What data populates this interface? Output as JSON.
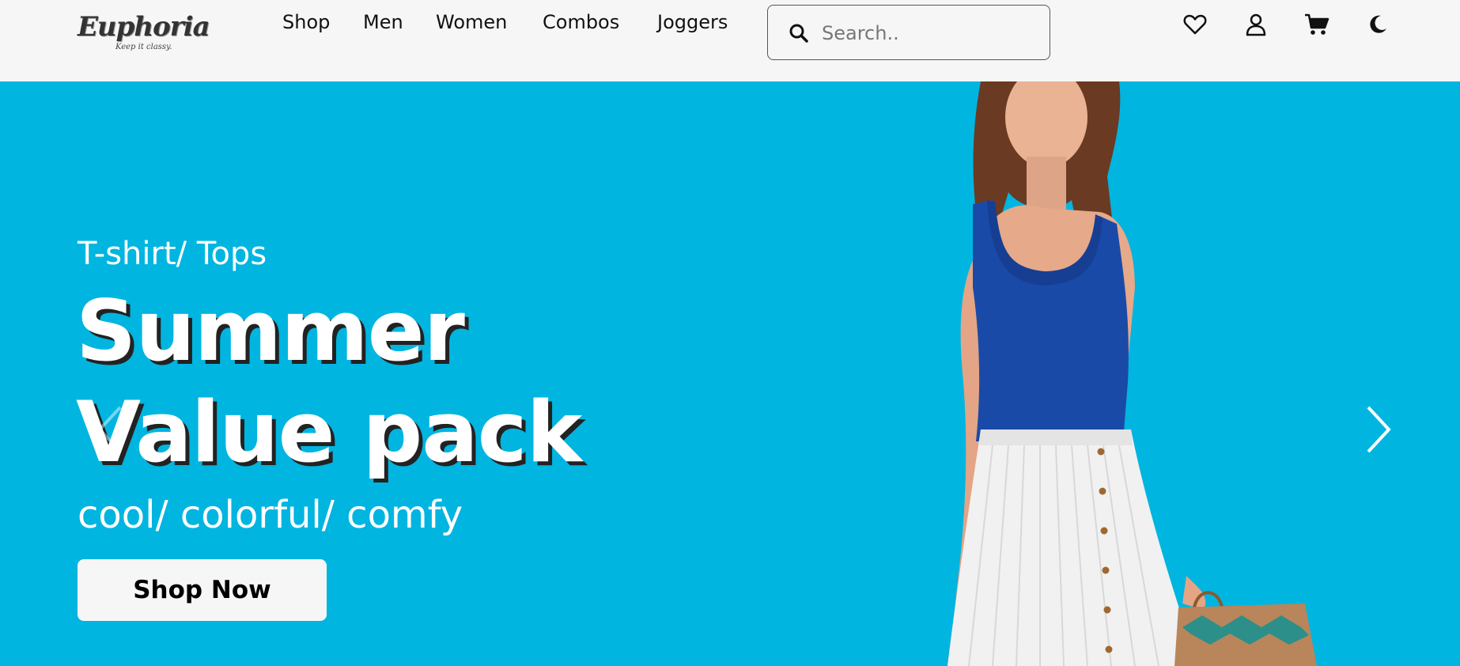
{
  "brand": {
    "name": "Euphoria",
    "tagline": "Keep it classy."
  },
  "nav": {
    "links": [
      "Shop",
      "Men",
      "Women",
      "Combos",
      "Joggers"
    ]
  },
  "search": {
    "placeholder": "Search..",
    "value": ""
  },
  "header_icons": [
    "heart-icon",
    "user-icon",
    "cart-icon",
    "moon-icon"
  ],
  "hero": {
    "subtitle": "T-shirt/ Tops",
    "headline_line1": "Summer",
    "headline_line2": "Value pack",
    "tagline": "cool/ colorful/ comfy",
    "cta_label": "Shop Now"
  },
  "colors": {
    "hero_background": "#00b5e0",
    "header_background": "#f6f6f6",
    "top": "#1a4aa8",
    "skirt": "#f1f1f1"
  }
}
